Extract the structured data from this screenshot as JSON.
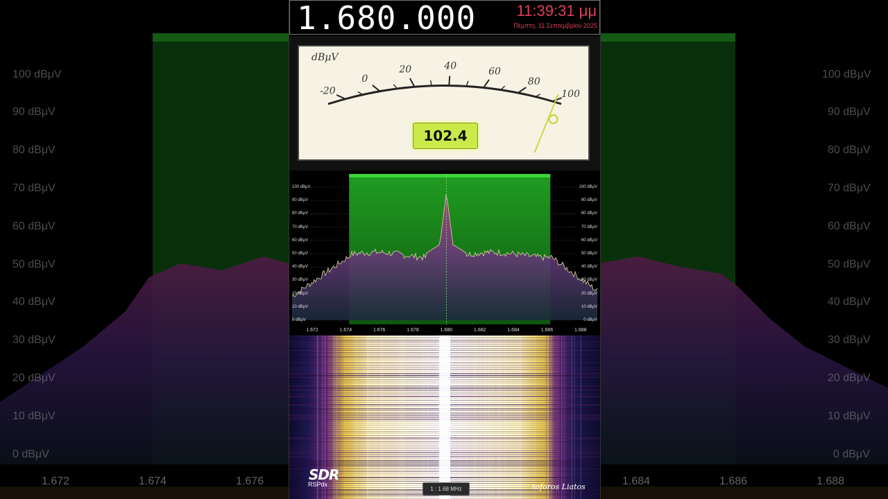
{
  "header": {
    "frequency": "1.680.000",
    "time": "11:39:31 μμ",
    "date": "Πέμπτη, 11 Σεπτεμβρίου 2025"
  },
  "meter": {
    "unit": "dBμV",
    "scale_labels": [
      "-20",
      "0",
      "20",
      "40",
      "60",
      "80",
      "100"
    ],
    "value": 102.4,
    "value_text": "102.4"
  },
  "spectrum": {
    "db_labels": [
      "100 dBμV",
      "90 dBμV",
      "80 dBμV",
      "70 dBμV",
      "60 dBμV",
      "50 dBμV",
      "40 dBμV",
      "30 dBμV",
      "20 dBμV",
      "10 dBμV",
      "0 dBμV"
    ],
    "freq_labels": [
      "1.672",
      "1.674",
      "1.676",
      "1.678",
      "1.680",
      "1.682",
      "1.684",
      "1.686",
      "1.688"
    ],
    "passband_color": "#1fb51f",
    "center_frequency_mhz": 1.68,
    "filter_start_mhz": 1.6742,
    "filter_end_mhz": 1.6862
  },
  "background": {
    "db_labels": [
      "100 dBμV",
      "90 dBμV",
      "80 dBμV",
      "70 dBμV",
      "60 dBμV",
      "50 dBμV",
      "40 dBμV",
      "30 dBμV",
      "20 dBμV",
      "10 dBμV",
      "0 dBμV"
    ],
    "freq_labels_left": [
      "1.672",
      "1.674",
      "1.676"
    ],
    "freq_labels_right": [
      "1.684",
      "1.686",
      "1.688"
    ]
  },
  "footer": {
    "logo": "SDR",
    "model": "RSPdx",
    "zoom": "1 : 1.68 MHz",
    "author": "toforos Liatos"
  },
  "colors": {
    "accent_red": "#e0405a",
    "meter_face": "#f6f3e4",
    "readout_bg": "#cce94a"
  }
}
